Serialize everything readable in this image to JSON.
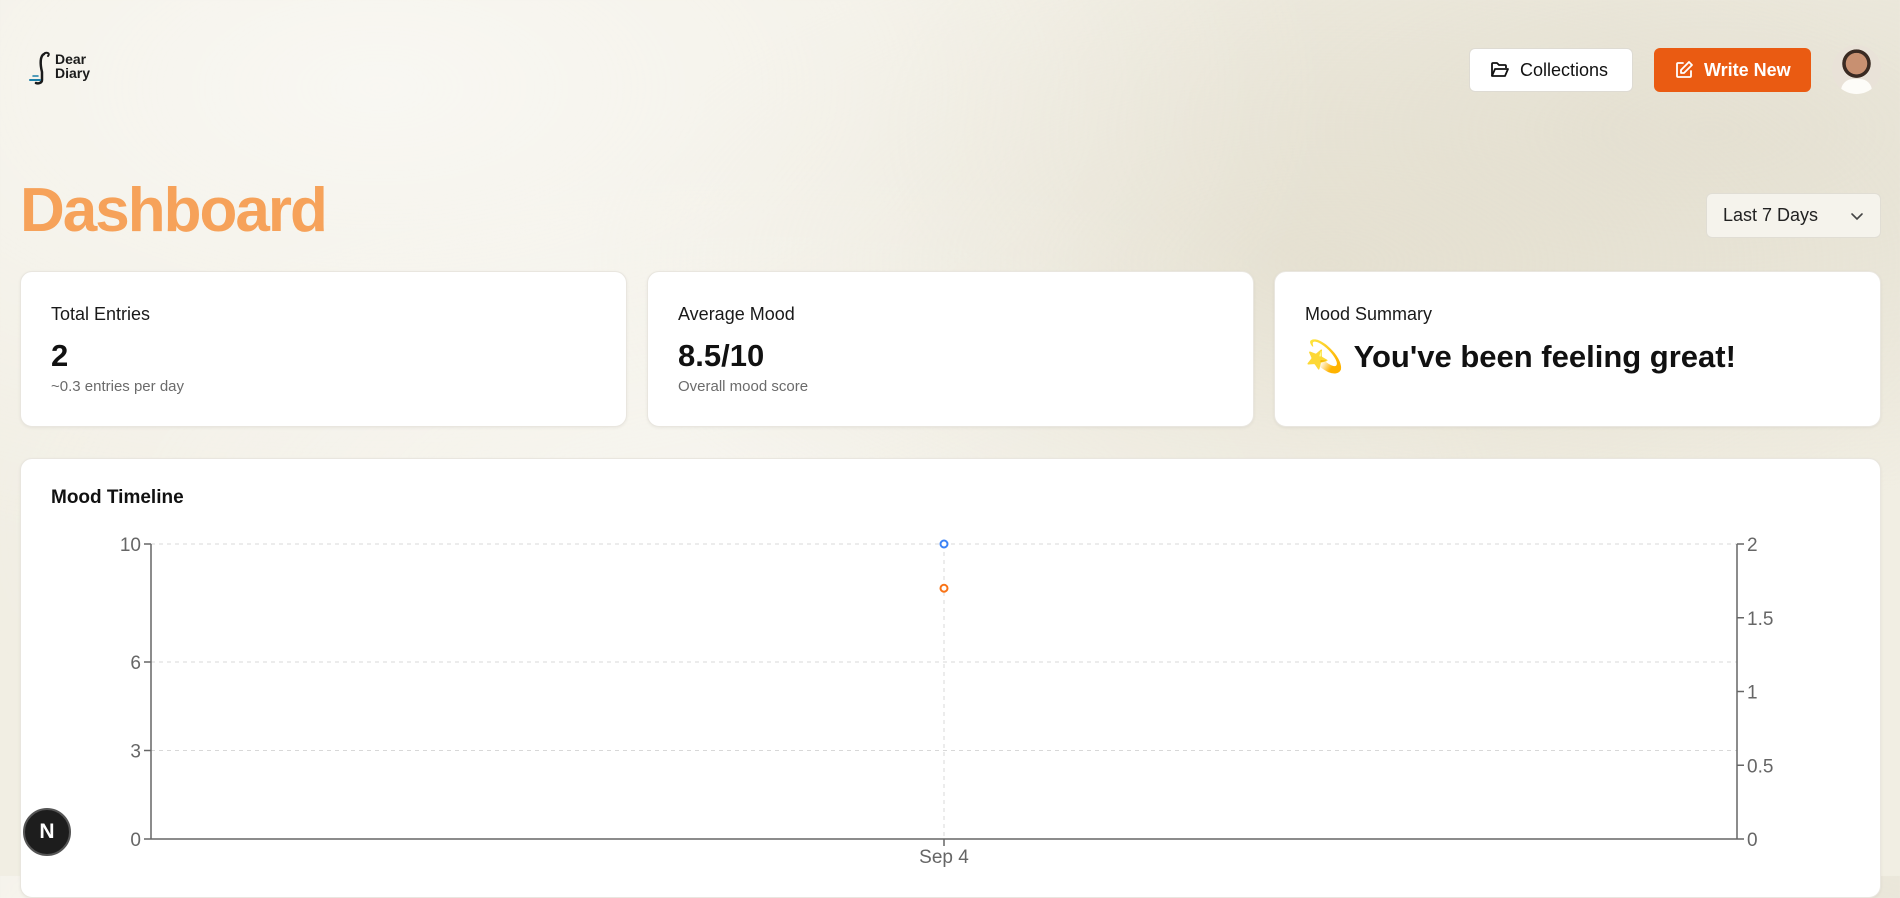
{
  "app": {
    "logo_line1": "Dear",
    "logo_line2": "Diary"
  },
  "header": {
    "collections_label": "Collections",
    "write_new_label": "Write New"
  },
  "page": {
    "title": "Dashboard",
    "range_select": "Last 7 Days"
  },
  "stats": {
    "total_entries": {
      "label": "Total Entries",
      "value": "2",
      "sub": "~0.3 entries per day"
    },
    "average_mood": {
      "label": "Average Mood",
      "value": "8.5/10",
      "sub": "Overall mood score"
    },
    "mood_summary": {
      "label": "Mood Summary",
      "emoji": "💫",
      "text": "You've been feeling great!"
    }
  },
  "timeline": {
    "title": "Mood Timeline"
  },
  "badge": {
    "letter": "N"
  },
  "colors": {
    "accent": "#ea5b12",
    "title": "#f6a25a",
    "series_blue": "#3b82f6",
    "series_orange": "#f97316"
  },
  "chart_data": {
    "type": "scatter",
    "x": [
      "Sep 4"
    ],
    "left_axis": {
      "ticks": [
        0,
        3,
        6,
        10
      ],
      "ylim": [
        0,
        10
      ]
    },
    "right_axis": {
      "ticks": [
        0,
        0.5,
        1,
        1.5,
        2
      ],
      "ylim": [
        0,
        2
      ]
    },
    "series": [
      {
        "axis": "left",
        "color": "#f97316",
        "values": [
          8.5
        ]
      },
      {
        "axis": "right",
        "color": "#3b82f6",
        "values": [
          2
        ]
      }
    ],
    "grid": true
  }
}
